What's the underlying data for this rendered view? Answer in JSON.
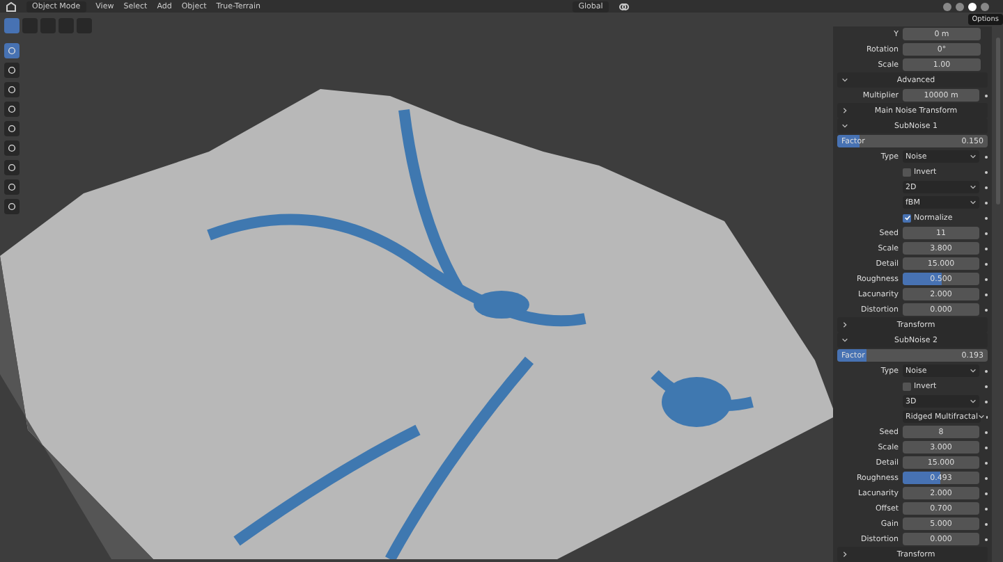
{
  "header": {
    "mode": "Object Mode",
    "menus": [
      "View",
      "Select",
      "Add",
      "Object",
      "True-Terrain"
    ],
    "orientation": "Global"
  },
  "tooltip": "Options",
  "panel": {
    "rows": [
      {
        "kind": "field",
        "label": "Y",
        "value": "0 m"
      },
      {
        "kind": "field",
        "label": "Rotation",
        "value": "0°"
      },
      {
        "kind": "field",
        "label": "Scale",
        "value": "1.00"
      },
      {
        "kind": "section",
        "label": "Advanced",
        "expanded": true
      },
      {
        "kind": "field",
        "label": "Multiplier",
        "value": "10000 m"
      },
      {
        "kind": "section",
        "label": "Main Noise Transform",
        "expanded": false
      },
      {
        "kind": "section",
        "label": "SubNoise 1",
        "expanded": true
      },
      {
        "kind": "slider",
        "label": "Factor",
        "value": "0.150",
        "level": 0.15
      },
      {
        "kind": "dropdown",
        "label": "Type",
        "value": "Noise"
      },
      {
        "kind": "checkbox",
        "label": "Invert",
        "checked": false
      },
      {
        "kind": "dropdown",
        "value": "2D"
      },
      {
        "kind": "dropdown",
        "value": "fBM"
      },
      {
        "kind": "checkbox",
        "label": "Normalize",
        "checked": true
      },
      {
        "kind": "field",
        "label": "Seed",
        "value": "11"
      },
      {
        "kind": "field",
        "label": "Scale",
        "value": "3.800"
      },
      {
        "kind": "field",
        "label": "Detail",
        "value": "15.000"
      },
      {
        "kind": "field",
        "label": "Roughness",
        "value": "0.500",
        "level": 0.5
      },
      {
        "kind": "field",
        "label": "Lacunarity",
        "value": "2.000"
      },
      {
        "kind": "field",
        "label": "Distortion",
        "value": "0.000"
      },
      {
        "kind": "section",
        "label": "Transform",
        "expanded": false
      },
      {
        "kind": "section",
        "label": "SubNoise 2",
        "expanded": true
      },
      {
        "kind": "slider",
        "label": "Factor",
        "value": "0.193",
        "level": 0.193
      },
      {
        "kind": "dropdown",
        "label": "Type",
        "value": "Noise"
      },
      {
        "kind": "checkbox",
        "label": "Invert",
        "checked": false
      },
      {
        "kind": "dropdown",
        "value": "3D"
      },
      {
        "kind": "dropdown",
        "value": "Ridged Multifractal"
      },
      {
        "kind": "field",
        "label": "Seed",
        "value": "8"
      },
      {
        "kind": "field",
        "label": "Scale",
        "value": "3.000"
      },
      {
        "kind": "field",
        "label": "Detail",
        "value": "15.000"
      },
      {
        "kind": "field",
        "label": "Roughness",
        "value": "0.493",
        "level": 0.493
      },
      {
        "kind": "field",
        "label": "Lacunarity",
        "value": "2.000"
      },
      {
        "kind": "field",
        "label": "Offset",
        "value": "0.700"
      },
      {
        "kind": "field",
        "label": "Gain",
        "value": "5.000"
      },
      {
        "kind": "field",
        "label": "Distortion",
        "value": "0.000"
      },
      {
        "kind": "section",
        "label": "Transform",
        "expanded": false
      }
    ]
  }
}
